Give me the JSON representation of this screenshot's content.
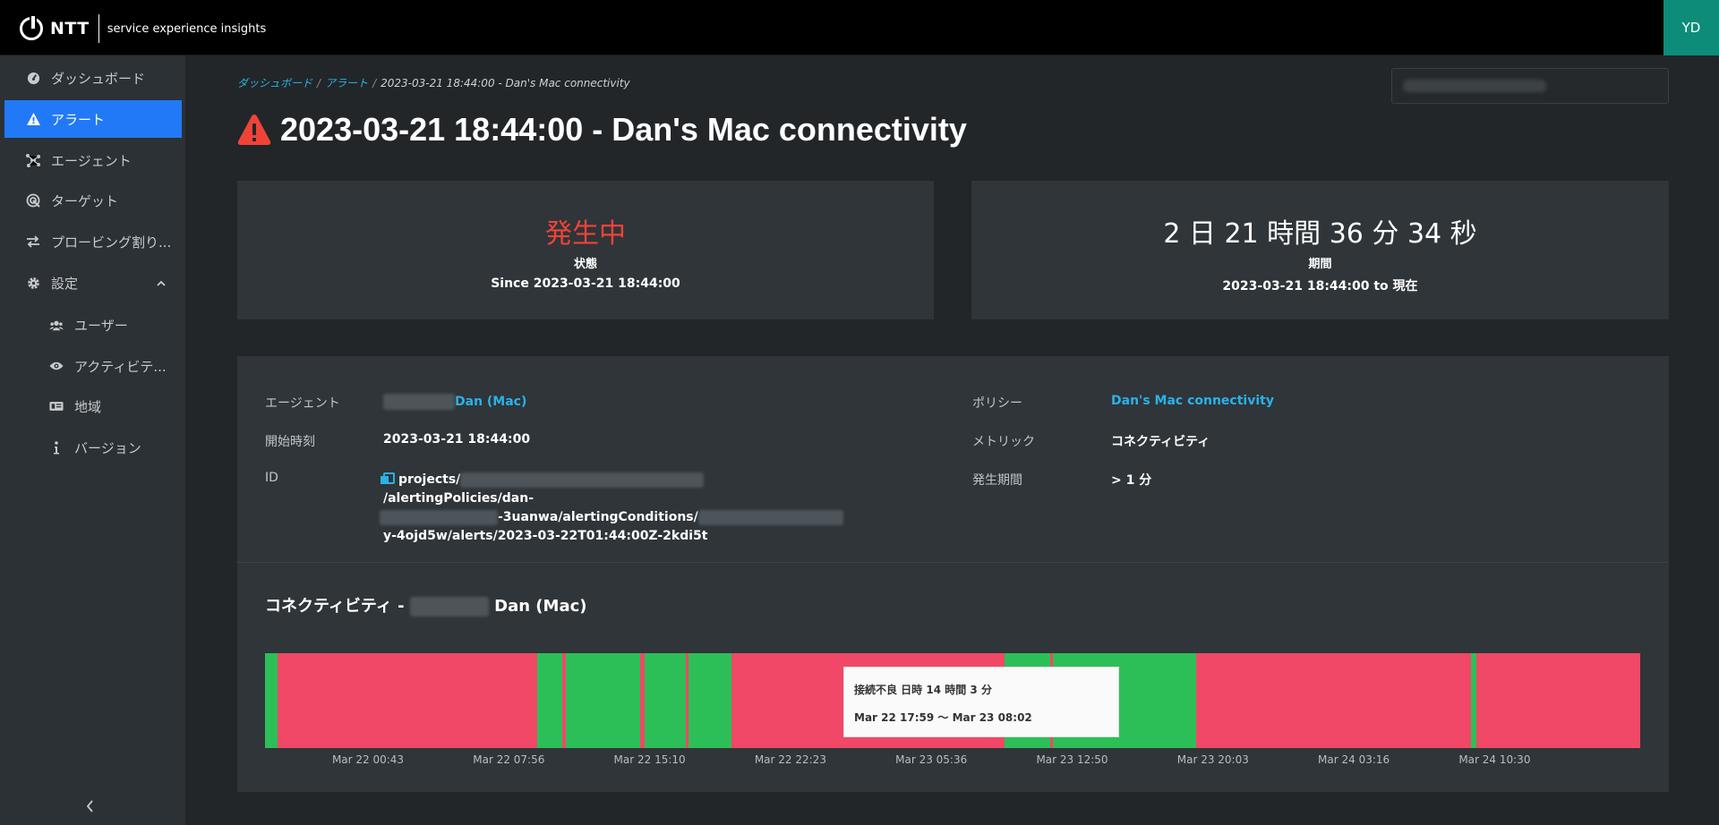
{
  "header": {
    "brand": "NTT",
    "product": "service experience insights",
    "avatar_initials": "YD"
  },
  "sidebar": {
    "items": [
      {
        "label": "ダッシュボード",
        "icon": "dashboard-icon"
      },
      {
        "label": "アラート",
        "icon": "warning-icon"
      },
      {
        "label": "エージェント",
        "icon": "agent-icon"
      },
      {
        "label": "ターゲット",
        "icon": "target-icon"
      },
      {
        "label": "プロービング割り...",
        "icon": "swap-icon"
      },
      {
        "label": "設定",
        "icon": "gear-icon"
      },
      {
        "label": "ユーザー",
        "icon": "users-icon"
      },
      {
        "label": "アクティビテ...",
        "icon": "eye-icon"
      },
      {
        "label": "地域",
        "icon": "region-icon"
      },
      {
        "label": "バージョン",
        "icon": "info-icon"
      }
    ],
    "collapse": "<"
  },
  "breadcrumb": {
    "dashboard": "ダッシュボード",
    "alerts": "アラート",
    "current": "2023-03-21 18:44:00 - Dan's Mac connectivity",
    "sep": "/"
  },
  "page": {
    "title": "2023-03-21 18:44:00 - Dan's Mac connectivity"
  },
  "status_card": {
    "value": "発生中",
    "label": "状態",
    "sub": "Since 2023-03-21 18:44:00"
  },
  "duration_card": {
    "value": "2 日 21 時間 36 分 34 秒",
    "label": "期間",
    "sub": "2023-03-21 18:44:00 to 現在"
  },
  "details": {
    "agent_label": "エージェント",
    "agent_value": "Dan (Mac)",
    "start_label": "開始時刻",
    "start_value": "2023-03-21 18:44:00",
    "id_label": "ID",
    "id_parts": [
      "projects/",
      "/alertingPolicies/dan-",
      "-3uanwa/alertingConditions/",
      "y-4ojd5w/alerts/2023-03-22T01:44:00Z-2kdi5t"
    ],
    "policy_label": "ポリシー",
    "policy_value": "Dan's Mac connectivity",
    "metric_label": "メトリック",
    "metric_value": "コネクティビティ",
    "period_label": "発生期間",
    "period_value": "> 1 分"
  },
  "chart": {
    "title_prefix": "コネクティビティ -",
    "title_suffix": "Dan (Mac)",
    "tick_labels": [
      "Mar 22 00:43",
      "Mar 22 07:56",
      "Mar 22 15:10",
      "Mar 22 22:23",
      "Mar 23 05:36",
      "Mar 23 12:50",
      "Mar 23 20:03",
      "Mar 24 03:16",
      "Mar 24 10:30"
    ],
    "tooltip_line1": "接続不良 日時 14 時間 3 分",
    "tooltip_line2": "Mar 22 17:59 〜 Mar 23 08:02",
    "colors": {
      "ok": "#2dbf57",
      "bad": "#f04866"
    }
  },
  "chart_data": {
    "type": "timeline",
    "x": [
      "Mar 22 00:43",
      "Mar 22 07:56",
      "Mar 22 15:10",
      "Mar 22 22:23",
      "Mar 23 05:36",
      "Mar 23 12:50",
      "Mar 23 20:03",
      "Mar 24 03:16",
      "Mar 24 10:30"
    ],
    "series": [
      {
        "status": "ok",
        "start_frac": 0.0,
        "end_frac": 0.009
      },
      {
        "status": "bad",
        "start_frac": 0.009,
        "end_frac": 0.198
      },
      {
        "status": "ok",
        "start_frac": 0.198,
        "end_frac": 0.216
      },
      {
        "status": "bad",
        "start_frac": 0.216,
        "end_frac": 0.219
      },
      {
        "status": "ok",
        "start_frac": 0.219,
        "end_frac": 0.273
      },
      {
        "status": "bad",
        "start_frac": 0.273,
        "end_frac": 0.276
      },
      {
        "status": "ok",
        "start_frac": 0.276,
        "end_frac": 0.306
      },
      {
        "status": "bad",
        "start_frac": 0.306,
        "end_frac": 0.308
      },
      {
        "status": "ok",
        "start_frac": 0.308,
        "end_frac": 0.339
      },
      {
        "status": "bad",
        "start_frac": 0.339,
        "end_frac": 0.538
      },
      {
        "status": "ok",
        "start_frac": 0.538,
        "end_frac": 0.571
      },
      {
        "status": "bad",
        "start_frac": 0.571,
        "end_frac": 0.573
      },
      {
        "status": "ok",
        "start_frac": 0.573,
        "end_frac": 0.677
      },
      {
        "status": "bad",
        "start_frac": 0.677,
        "end_frac": 0.877
      },
      {
        "status": "ok",
        "start_frac": 0.877,
        "end_frac": 0.881
      },
      {
        "status": "bad",
        "start_frac": 0.881,
        "end_frac": 1.0
      }
    ]
  }
}
